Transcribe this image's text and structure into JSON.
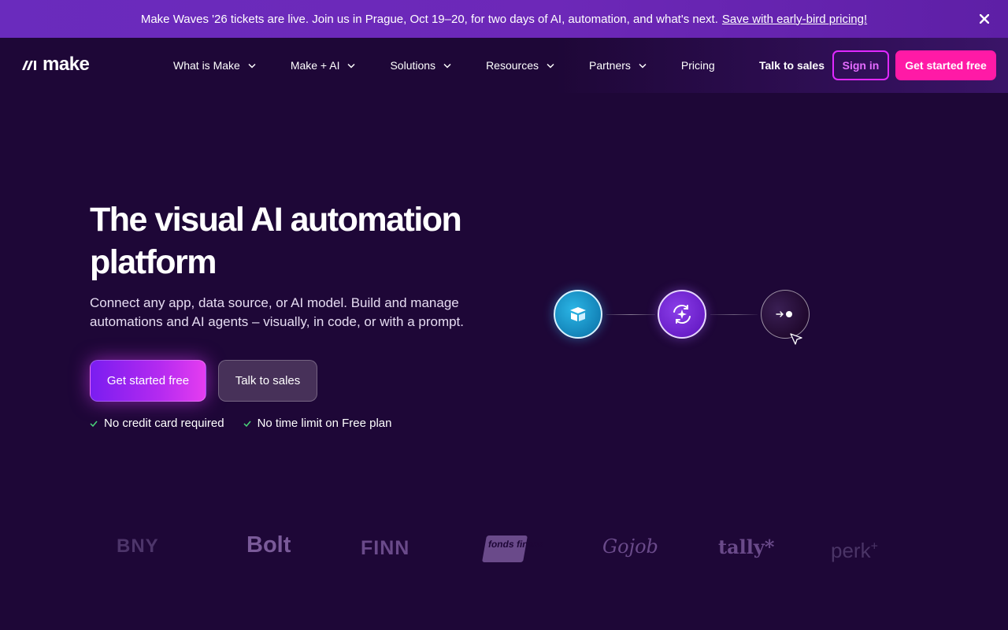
{
  "announcement": {
    "message": "Make Waves '26 tickets are live. Join us in Prague, Oct 19–20, for two days of AI, automation, and what's next.",
    "link_text": "Save with early-bird pricing!"
  },
  "brand": {
    "name": "make"
  },
  "nav": {
    "items": [
      {
        "label": "What is Make",
        "has_dropdown": true
      },
      {
        "label": "Make + AI",
        "has_dropdown": true
      },
      {
        "label": "Solutions",
        "has_dropdown": true
      },
      {
        "label": "Resources",
        "has_dropdown": true
      },
      {
        "label": "Partners",
        "has_dropdown": true
      },
      {
        "label": "Pricing",
        "has_dropdown": false
      }
    ],
    "talk_to_sales": "Talk to sales",
    "sign_in": "Sign in",
    "get_started": "Get started free"
  },
  "hero": {
    "title": "The visual AI automation platform",
    "subtitle": "Connect any app, data source, or AI model. Build and manage automations and AI agents – visually, in code, or with a prompt.",
    "primary_cta": "Get started free",
    "secondary_cta": "Talk to sales",
    "perks": [
      "No credit card required",
      "No time limit on Free plan"
    ]
  },
  "flow": {
    "nodes": [
      {
        "icon": "airtable-icon",
        "color": "#1383b8"
      },
      {
        "icon": "ai-sparkle-icon",
        "color": "#6a1fc9"
      },
      {
        "icon": "arrow-dot-icon",
        "color": "#21092f"
      }
    ]
  },
  "customer_logos": [
    "BNY",
    "Bolt",
    "FINN",
    "fonds finanz",
    "Gojob",
    "tally*",
    "perk"
  ],
  "colors": {
    "background": "#1e0737",
    "announcement": "#6a2bbd",
    "accent_pink": "#ff1aa6",
    "accent_purple": "#e029ff",
    "check_green": "#4ad67a"
  }
}
